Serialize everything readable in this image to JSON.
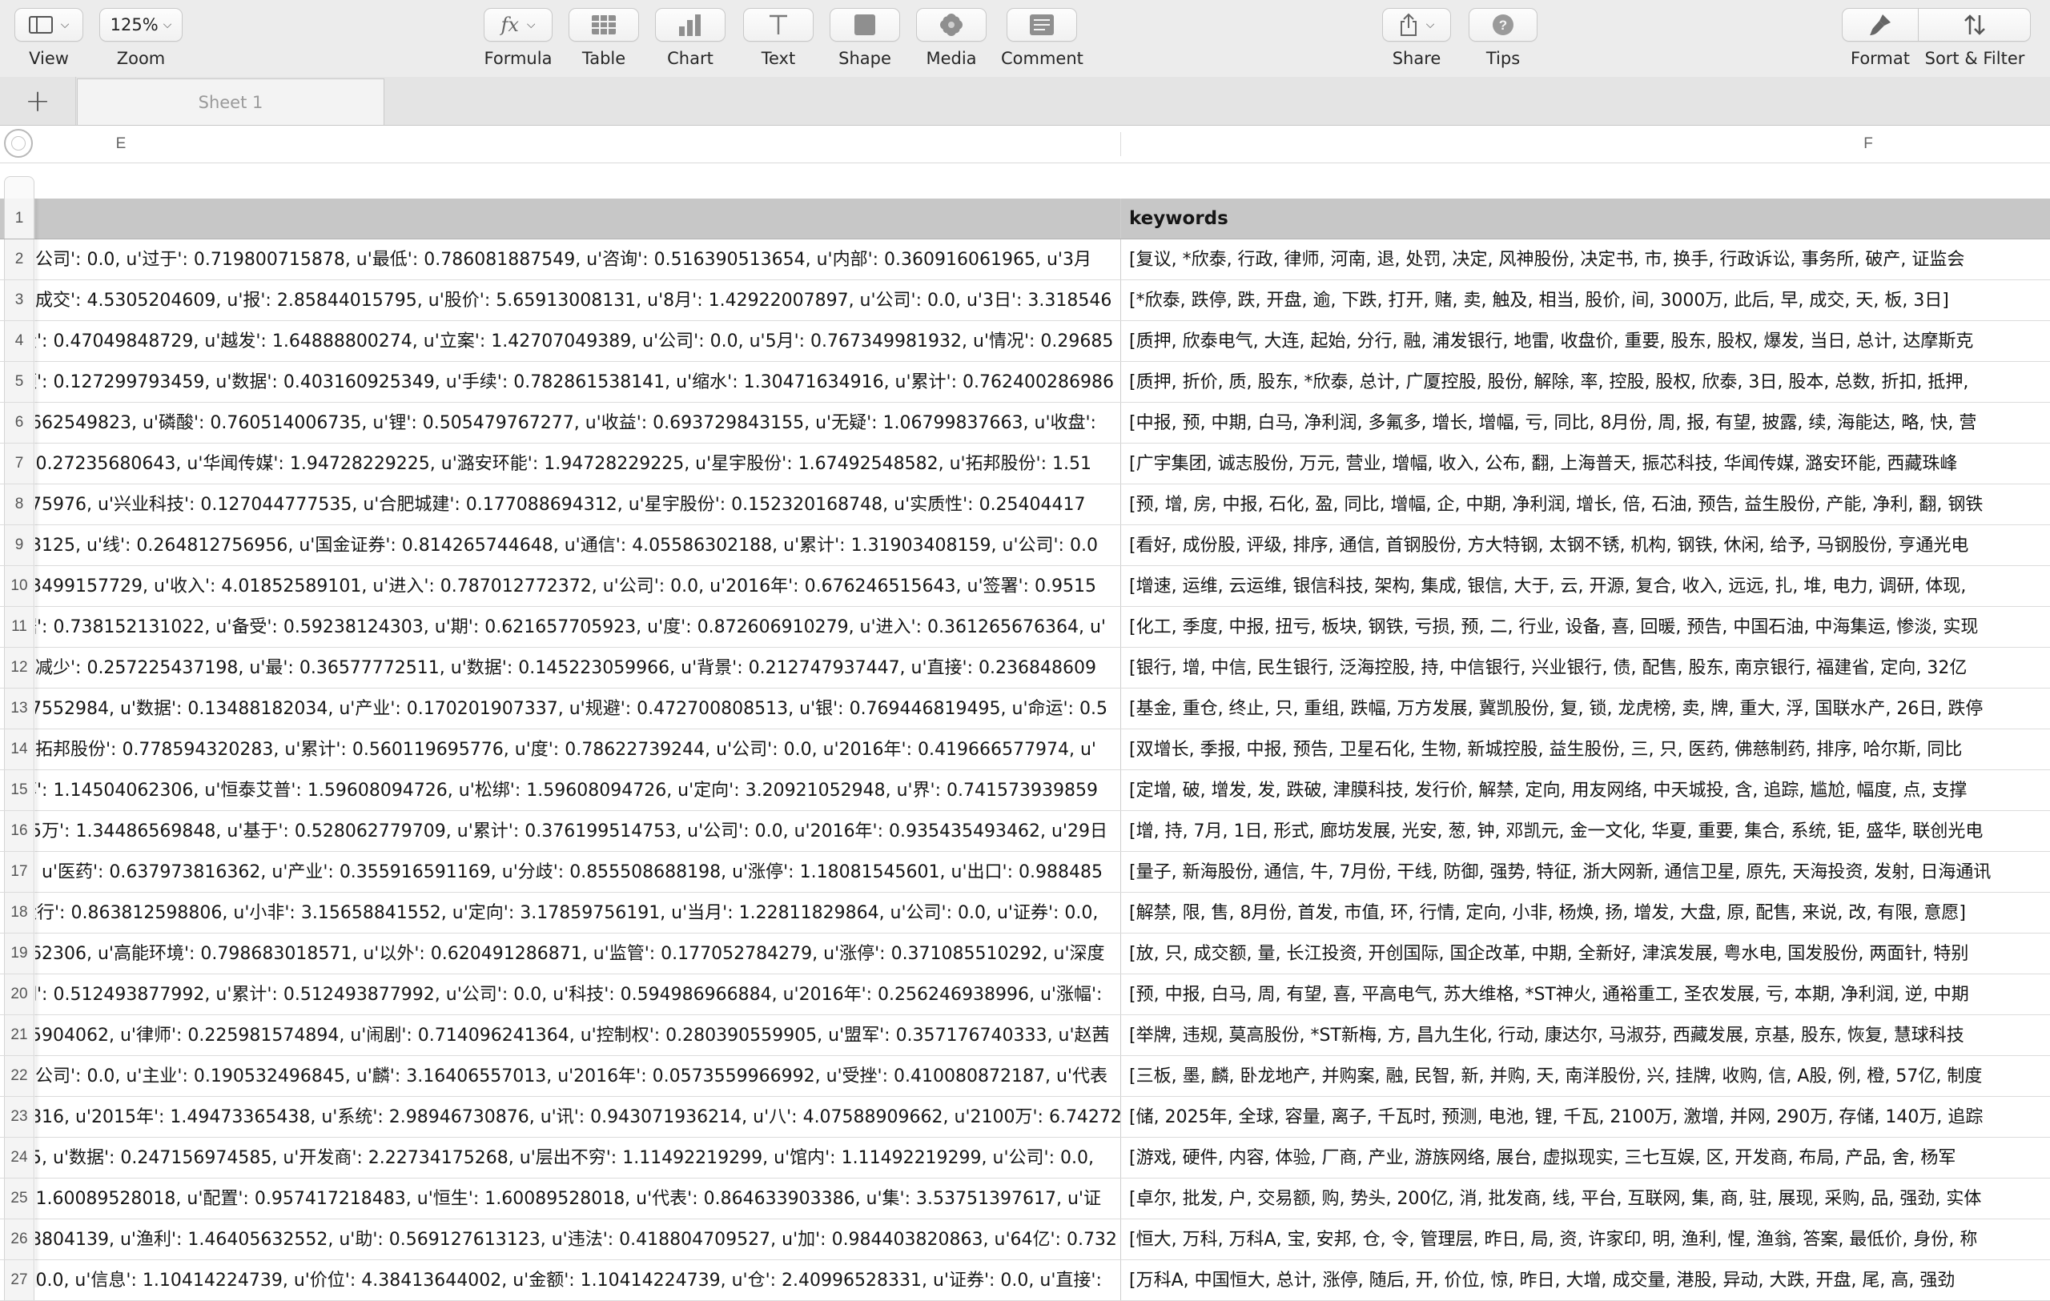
{
  "toolbar": {
    "view": {
      "label": "View",
      "icon": "sidebar-view-icon"
    },
    "zoom": {
      "label": "Zoom",
      "value": "125%"
    },
    "formula": {
      "label": "Formula",
      "icon": "fx-icon"
    },
    "table": {
      "label": "Table",
      "icon": "table-icon"
    },
    "chart": {
      "label": "Chart",
      "icon": "bar-chart-icon"
    },
    "text": {
      "label": "Text",
      "icon": "text-icon"
    },
    "shape": {
      "label": "Shape",
      "icon": "square-shape-icon"
    },
    "media": {
      "label": "Media",
      "icon": "flower-media-icon"
    },
    "comment": {
      "label": "Comment",
      "icon": "comment-icon"
    },
    "share": {
      "label": "Share",
      "icon": "share-icon"
    },
    "tips": {
      "label": "Tips",
      "icon": "question-icon"
    },
    "format": {
      "label": "Format",
      "icon": "paintbrush-icon"
    },
    "sort_filter": {
      "label": "Sort & Filter",
      "icon": "sort-arrows-icon"
    }
  },
  "tabs": {
    "add_label": "+",
    "sheets": [
      {
        "label": "Sheet 1"
      }
    ]
  },
  "columns": {
    "e": "E",
    "f": "F"
  },
  "header_row": {
    "num": "1",
    "e": "",
    "f": "keywords"
  },
  "rows": [
    {
      "num": "2",
      "e": "u'公司': 0.0, u'过于': 0.719800715878, u'最低': 0.786081887549, u'咨询': 0.516390513654, u'内部': 0.360916061965, u'3月",
      "f": "[复议, *欣泰, 行政, 律师, 河南, 退, 处罚, 决定, 风神股份, 决定书, 市, 换手, 行政诉讼, 事务所, 破产, 证监会"
    },
    {
      "num": "3",
      "e": "u'成交': 4.5305204609, u'报': 2.85844015795, u'股价': 5.65913008131, u'8月': 1.42922007897, u'公司': 0.0, u'3日': 3.318546",
      "f": "[*欣泰, 跌停, 跌, 开盘, 逾, 下跌, 打开, 赌, 卖, 触及, 相当, 股价, 间, 3000万, 此后, 早, 成交, 天, 板, 3日]"
    },
    {
      "num": "4",
      "e": "段': 0.47049848729, u'越发': 1.64888800274, u'立案': 1.42707049389, u'公司': 0.0, u'5月': 0.767349981932, u'情况': 0.29685",
      "f": "[质押, 欣泰电气, 大连, 起始, 分行, 融, 浦发银行, 地雷, 收盘价, 重要, 股东, 股权, 爆发, 当日, 总计, 达摩斯克"
    },
    {
      "num": "5",
      "e": "额': 0.127299793459, u'数据': 0.403160925349, u'手续': 0.782861538141, u'缩水': 1.30471634916, u'累计': 0.762400286986",
      "f": "[质押, 折价, 质, 股东, *欣泰, 总计, 广厦控股, 股份, 解除, 率, 控股, 股权, 欣泰, 3日, 股本, 总数, 折扣, 抵押,"
    },
    {
      "num": "6",
      "e": "1662549823, u'磷酸': 0.760514006735, u'锂': 0.505479767277, u'收益': 0.693729843155, u'无疑': 1.06799837663, u'收盘':",
      "f": "[中报, 预, 中期, 白马, 净利润, 多氟多, 增长, 增幅, 亏, 同比, 8月份, 周, 报, 有望, 披露, 续, 海能达, 略, 快, 营"
    },
    {
      "num": "7",
      "e": "': 0.27235680643, u'华闻传媒': 1.94728229225, u'潞安环能': 1.94728229225, u'星宇股份': 1.67492548582, u'拓邦股份': 1.51",
      "f": "[广宇集团, 诚志股份, 万元, 营业, 增幅, 收入, 公布, 翻, 上海普天, 振芯科技, 华闻传媒, 潞安环能, 西藏珠峰"
    },
    {
      "num": "8",
      "e": "975976, u'兴业科技': 0.127044777535, u'合肥城建': 0.177088694312, u'星宇股份': 0.152320168748, u'实质性': 0.25404417",
      "f": "[预, 增, 房, 中报, 石化, 盈, 同比, 增幅, 企, 中期, 净利润, 增长, 倍, 石油, 预告, 益生股份, 产能, 净利, 翻, 钢铁"
    },
    {
      "num": "9",
      "e": "23125, u'线': 0.264812756956, u'国金证券': 0.814265744648, u'通信': 4.05586302188, u'累计': 1.31903408159, u'公司': 0.0",
      "f": "[看好, 成份股, 评级, 排序, 通信, 首钢股份, 方大特钢, 太钢不锈, 机构, 钢铁, 休闲, 给予, 马钢股份, 亨通光电"
    },
    {
      "num": "10",
      "e": "83499157729, u'收入': 4.01852589101, u'进入': 0.787012772372, u'公司': 0.0, u'2016年': 0.676246515643, u'签署': 0.9515",
      "f": "[增速, 运维, 云运维, 银信科技, 架构, 集成, 银信, 大于, 云, 开源, 复合, 收入, 远远, 扎, 堆, 电力, 调研, 体现,"
    },
    {
      "num": "11",
      "e": "据': 0.738152131022, u'备受': 0.59238124303, u'期': 0.621657705923, u'度': 0.872606910279, u'进入': 0.361265676364, u'",
      "f": "[化工, 季度, 中报, 扭亏, 板块, 钢铁, 亏损, 预, 二, 行业, 设备, 喜, 回暖, 预告, 中国石油, 中海集运, 惨淡, 实现"
    },
    {
      "num": "12",
      "e": "u'减少': 0.257225437198, u'最': 0.36577772511, u'数据': 0.145223059966, u'背景': 0.212747937447, u'直接': 0.236848609",
      "f": "[银行, 增, 中信, 民生银行, 泛海控股, 持, 中信银行, 兴业银行, 债, 配售, 股东, 南京银行, 福建省, 定向, 32亿"
    },
    {
      "num": "13",
      "e": "07552984, u'数据': 0.13488182034, u'产业': 0.170201907337, u'规避': 0.472700808513, u'银': 0.769446819495, u'命运': 0.5",
      "f": "[基金, 重仓, 终止, 只, 重组, 跌幅, 万方发展, 冀凯股份, 复, 锁, 龙虎榜, 卖, 牌, 重大, 浮, 国联水产, 26日, 跌停"
    },
    {
      "num": "14",
      "e": "u'拓邦股份': 0.778594320283, u'累计': 0.560119695776, u'度': 0.78622739244, u'公司': 0.0, u'2016年': 0.419666577974, u'",
      "f": "[双增长, 季报, 中报, 预告, 卫星石化, 生物, 新城控股, 益生股份, 三, 只, 医药, 佛慈制药, 排序, 哈尔斯, 同比"
    },
    {
      "num": "15",
      "e": "率': 1.14504062306, u'恒泰艾普': 1.59608094726, u'松绑': 1.59608094726, u'定向': 3.20921052948, u'界': 0.741573939859",
      "f": "[定增, 破, 增发, 发, 跌破, 津膜科技, 发行价, 解禁, 定向, 用友网络, 中天城投, 含, 追踪, 尴尬, 幅度, 点, 支撑"
    },
    {
      "num": "16",
      "e": "65万': 1.34486569848, u'基于': 0.528062779709, u'累计': 0.376199514753, u'公司': 0.0, u'2016年': 0.935435493462, u'29日",
      "f": "[增, 持, 7月, 1日, 形式, 廊坊发展, 光安, 葱, 钟, 邓凯元, 金一文化, 华夏, 重要, 集合, 系统, 钜, 盛华, 联创光电"
    },
    {
      "num": "17",
      "e": "4, u'医药': 0.637973816362, u'产业': 0.355916591169, u'分歧': 0.855508688198, u'涨停': 1.18081545601, u'出口': 0.988485",
      "f": "[量子, 新海股份, 通信, 牛, 7月份, 干线, 防御, 强势, 特征, 浙大网新, 通信卫星, 原先, 天海投资, 发射, 日海通讯"
    },
    {
      "num": "18",
      "e": "运行': 0.863812598806, u'小非': 3.15658841552, u'定向': 3.17859756191, u'当月': 1.22811829864, u'公司': 0.0, u'证券': 0.0,",
      "f": "[解禁, 限, 售, 8月份, 首发, 市值, 环, 行情, 定向, 小非, 杨焕, 扬, 增发, 大盘, 原, 配售, 来说, 改, 有限, 意愿]"
    },
    {
      "num": "19",
      "e": "062306, u'高能环境': 0.798683018571, u'以外': 0.620491286871, u'监管': 0.177052784279, u'涨停': 0.371085510292, u'深度",
      "f": "[放, 只, 成交额, 量, 长江投资, 开创国际, 国企改革, 中期, 全新好, 津滨发展, 粤水电, 国发股份, 两面针, 特别"
    },
    {
      "num": "20",
      "e": "期': 0.512493877992, u'累计': 0.512493877992, u'公司': 0.0, u'科技': 0.594986966884, u'2016年': 0.256246938996, u'涨幅':",
      "f": "[预, 中报, 白马, 周, 有望, 喜, 平高电气, 苏大维格, *ST神火, 通裕重工, 圣农发展, 亏, 本期, 净利润, 逆, 中期"
    },
    {
      "num": "21",
      "e": "35904062, u'律师': 0.225981574894, u'闹剧': 0.714096241364, u'控制权': 0.280390559905, u'盟军': 0.357176740333, u'赵茜",
      "f": "[举牌, 违规, 莫高股份, *ST新梅, 方, 昌九生化, 行动, 康达尔, 马淑芬, 西藏发展, 京基, 股东, 恢复, 慧球科技"
    },
    {
      "num": "22",
      "e": "u'公司': 0.0, u'主业': 0.190532496845, u'麟': 3.16406557013, u'2016年': 0.0573559966992, u'受挫': 0.410080872187, u'代表",
      "f": "[三板, 墨, 麟, 卧龙地产, 并购案, 融, 民智, 新, 并购, 天, 南洋股份, 兴, 挂牌, 收购, 信, A股, 例, 橙, 57亿, 制度"
    },
    {
      "num": "23",
      "e": "2816, u'2015年': 1.49473365438, u'系统': 2.98946730876, u'讯': 0.943071936214, u'八': 4.07588909662, u'2100万': 6.74272",
      "f": "[储, 2025年, 全球, 容量, 离子, 千瓦时, 预测, 电池, 锂, 千瓦, 2100万, 激增, 并网, 290万, 存储, 140万, 追踪"
    },
    {
      "num": "24",
      "e": "15, u'数据': 0.247156974585, u'开发商': 2.22734175268, u'层出不穷': 1.11492219299, u'馆内': 1.11492219299, u'公司': 0.0,",
      "f": "[游戏, 硬件, 内容, 体验, 厂商, 产业, 游族网络, 展台, 虚拟现实, 三七互娱, 区, 开发商, 布局, 产品, 舍, 杨军"
    },
    {
      "num": "25",
      "e": "': 1.60089528018, u'配置': 0.957417218483, u'恒生': 1.60089528018, u'代表': 0.864633903386, u'集': 3.53751397617, u'证",
      "f": "[卓尔, 批发, 户, 交易额, 购, 势头, 200亿, 消, 批发商, 线, 平台, 互联网, 集, 商, 驻, 展现, 采购, 品, 强劲, 实体"
    },
    {
      "num": "26",
      "e": "58804139, u'渔利': 1.46405632552, u'助': 0.569127613123, u'违法': 0.418804709527, u'加': 0.984403820863, u'64亿': 0.732",
      "f": "[恒大, 万科, 万科A, 宝, 安邦, 仓, 令, 管理层, 昨日, 局, 资, 许家印, 明, 渔利, 惺, 渔翁, 答案, 最低价, 身份, 称"
    },
    {
      "num": "27",
      "e": "': 0.0, u'信息': 1.10414224739, u'价位': 4.38413644002, u'金额': 1.10414224739, u'仓': 2.40996528331, u'证券': 0.0, u'直接':",
      "f": "[万科A, 中国恒大, 总计, 涨停, 随后, 开, 价位, 惊, 昨日, 大增, 成交量, 港股, 异动, 大跌, 开盘, 尾, 高, 强劲"
    }
  ]
}
